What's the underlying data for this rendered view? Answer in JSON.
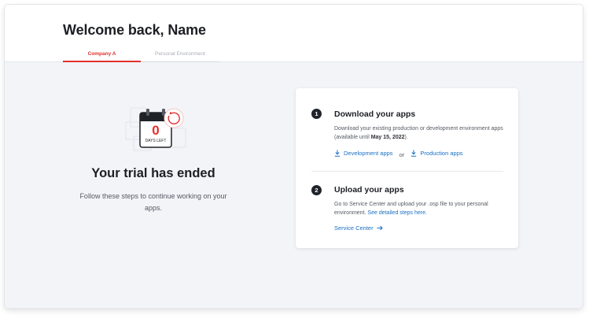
{
  "header": {
    "title": "Welcome back, Name",
    "tabs": [
      {
        "label": "Company A",
        "active": true
      },
      {
        "label": "Personal Environment",
        "active": false
      }
    ]
  },
  "trial": {
    "days_number": "0",
    "days_label": "DAYS LEFT",
    "title": "Your trial has ended",
    "description": "Follow these steps to continue working on your apps."
  },
  "steps": [
    {
      "number": "1",
      "title": "Download your apps",
      "description_prefix": "Download your existing production or development environment apps (available until ",
      "description_date": "May 15, 2022",
      "description_suffix": ").",
      "link_development": "Development apps",
      "separator": "or",
      "link_production": "Production apps"
    },
    {
      "number": "2",
      "title": "Upload your apps",
      "description": "Go to Service Center and upload your .osp file to your personal environment.",
      "description_link": "See detailed steps here.",
      "service_link": "Service Center"
    }
  ],
  "colors": {
    "accent_red": "#e2302c",
    "link_blue": "#1a6fc4",
    "page_background": "#f2f4f8"
  },
  "icons": [
    "download-icon",
    "arrow-right-icon",
    "calendar-icon",
    "refresh-icon"
  ]
}
